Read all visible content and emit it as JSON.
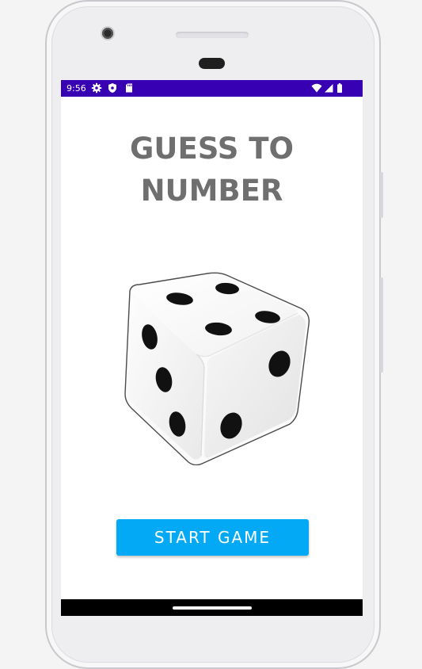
{
  "status_bar": {
    "time": "9:56",
    "background_color": "#3700b3",
    "left_icons": [
      "settings-icon",
      "shield-icon",
      "sd-card-icon"
    ],
    "right_icons": [
      "wifi-icon",
      "cell-signal-icon",
      "battery-icon"
    ]
  },
  "app": {
    "title_line1": "GUESS TO",
    "title_line2": "NUMBER",
    "title_color": "#6f6f6f",
    "image": "dice-image",
    "start_button_label": "START GAME",
    "start_button_color": "#03a9f4"
  },
  "nav_bar": {
    "background_color": "#000000",
    "handle": "home-gesture-handle"
  }
}
